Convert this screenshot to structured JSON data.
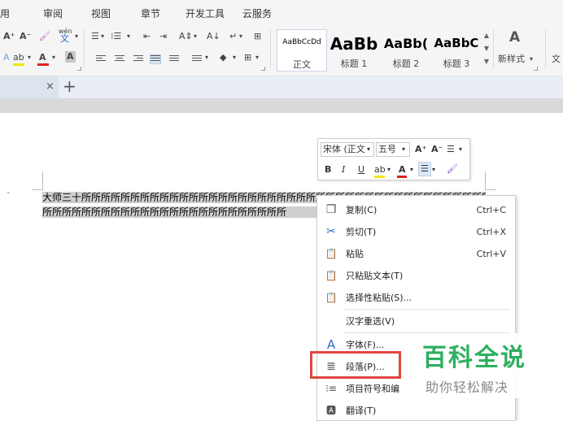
{
  "menu_tabs": [
    "用",
    "审阅",
    "视图",
    "章节",
    "开发工具",
    "云服务"
  ],
  "ribbon": {
    "font_grow": "A⁺",
    "font_shrink": "A⁻",
    "clear_format": "🖌",
    "pinyin_guide": "wén",
    "pinyin_char": "文",
    "font_color_letter": "A",
    "char_shading_letter": "A",
    "text_effect": "A",
    "highlight_label": "ab",
    "bullet_list": "☰",
    "numbered_list": "⁝☰",
    "decrease_indent": "⇤",
    "increase_indent": "⇥",
    "char_spacing": "A⇕",
    "sort": "A↓",
    "para_mark": "↵",
    "table": "⊞",
    "shading": "◆",
    "border": "⊞",
    "dropdown": "▾",
    "styles": [
      {
        "sample": "AaBbCcDd",
        "name": "正文"
      },
      {
        "sample": "AaBb",
        "name": "标题 1"
      },
      {
        "sample": "AaBb(",
        "name": "标题 2"
      },
      {
        "sample": "AaBbC",
        "name": "标题 3"
      }
    ],
    "new_style_icon": "A",
    "new_style_label": "新样式",
    "text_tools_label": "文"
  },
  "doc_tab": {
    "close": "×",
    "add": "+"
  },
  "document": {
    "line1": "大师三十所所所所所所所所所所所所所所所所所所所所所所所所所所所所所所所所所所所所所所所所所所所所所所所所所所所所所所所所所",
    "line2": "所所所所所所所所所所所所所所所所所所所所所所所所所",
    "paragraph_marker": "˅"
  },
  "mini_toolbar": {
    "font_name": "宋体 (正文",
    "font_size": "五号",
    "grow": "A⁺",
    "shrink": "A⁻",
    "line_spacing": "☰",
    "bold": "B",
    "italic": "I",
    "underline": "U",
    "highlight": "ab",
    "font_color": "A",
    "align": "☰",
    "format_painter": "🖌",
    "dropdown": "▾"
  },
  "context_menu": {
    "items": [
      {
        "icon": "❐",
        "label": "复制(C)",
        "shortcut": "Ctrl+C"
      },
      {
        "icon": "✂",
        "label": "剪切(T)",
        "shortcut": "Ctrl+X"
      },
      {
        "icon": "📋",
        "label": "粘贴",
        "shortcut": "Ctrl+V"
      },
      {
        "icon": "📋",
        "label": "只粘贴文本(T)",
        "shortcut": ""
      },
      {
        "icon": "📋",
        "label": "选择性粘贴(S)...",
        "shortcut": ""
      },
      {
        "icon": "",
        "label": "汉字重选(V)",
        "shortcut": ""
      },
      {
        "icon": "A",
        "label": "字体(F)...",
        "shortcut": ""
      },
      {
        "icon": "≣",
        "label": "段落(P)...",
        "shortcut": ""
      },
      {
        "icon": "⁝≡",
        "label": "项目符号和编",
        "shortcut": ""
      },
      {
        "icon": "🅰",
        "label": "翻译(T)",
        "shortcut": ""
      }
    ]
  },
  "watermark": {
    "title": "百科全说",
    "subtitle": "助你轻松解决"
  },
  "colors": {
    "highlight_box": "#e0463f",
    "watermark_green": "#2eaf5f",
    "font_color_bar": "#e02020",
    "highlight_bar": "#f3e600",
    "accent_blue": "#2b6cc4"
  }
}
